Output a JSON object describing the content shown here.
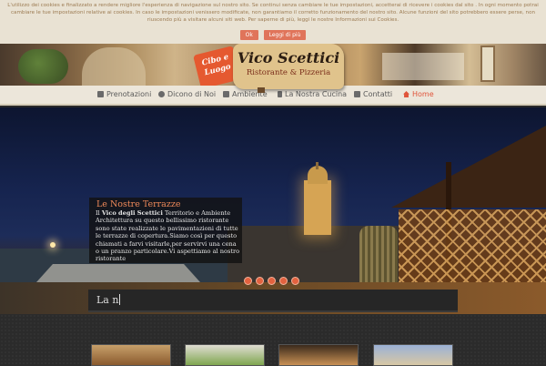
{
  "cookie": {
    "text": "L'utilizzo dei cookies e finalizzato a rendere migliore l'esperienza di navigazione sul nostro sito. Se continui senza cambiare le tue impostazioni, accetterai di ricevere i cookies dal sito . In ogni momento potrai cambiare le tue impostazioni relative ai cookies. In caso le impostazioni venissero modificate, non garantiamo il corretto funzionamento del nostro sito. Alcune funzioni del sito potrebbero essere perse, non riuscendo più a visitare alcuni siti web. Per saperne di più, leggi le nostre Informazioni sui Cookies.",
    "ok_label": "Ok",
    "more_label": "Leggi di più"
  },
  "header": {
    "badge_text": "Cibo e Luogo",
    "logo_name": "Vico Scettici",
    "logo_subtitle": "Ristorante & Pizzeria"
  },
  "nav": {
    "items": [
      {
        "label": "Prenotazioni",
        "icon": "edit-icon"
      },
      {
        "label": "Dicono di Noi",
        "icon": "comment-icon"
      },
      {
        "label": "Ambiente",
        "icon": "camera-icon"
      },
      {
        "label": "La Nostra Cucina",
        "icon": "food-icon"
      },
      {
        "label": "Contatti",
        "icon": "mail-icon"
      },
      {
        "label": "Home",
        "icon": "home-icon",
        "active": true
      }
    ]
  },
  "hero": {
    "caption_title": "Le Nostre Terrazze",
    "caption_intro": "Il ",
    "caption_bold": "Vico degli Scettici",
    "caption_body": " Territorio e Ambiente Architettura su questo bellissimo ristorante sono state realizzate le pavimentazioni di tutte le terrazze di copertura.Siamo così per questo chiamati a farvi visitarle,per servirvi una cena o un pranzo particolare.Vi aspettiamo al nostro ristorante",
    "slide_count": 5
  },
  "ticker": {
    "text": "La n"
  },
  "colors": {
    "accent": "#e0543a",
    "cookie_bg": "#e9e2d3",
    "nav_bg": "#ece6da"
  }
}
